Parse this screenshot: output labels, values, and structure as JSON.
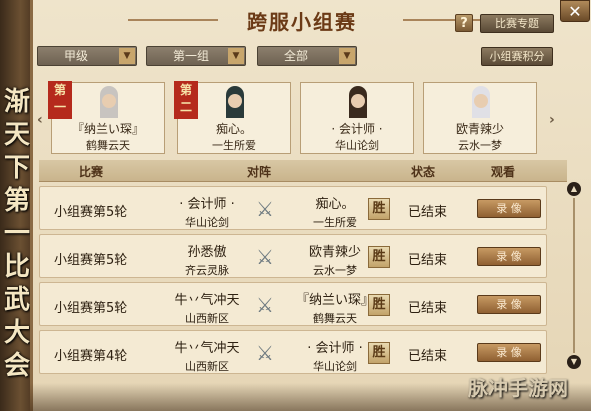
{
  "banner": {
    "text": "渐天下第一比武大会"
  },
  "header": {
    "title": "跨服小组赛",
    "help_label": "?",
    "topic_label": "比赛专题",
    "close_label": "✕"
  },
  "filters": {
    "level": "甲级",
    "group": "第一组",
    "scope": "全部",
    "points_label": "小组赛积分"
  },
  "nav": {
    "prev": "‹",
    "next": "›"
  },
  "cards": [
    {
      "rank": "第一",
      "name": "『纳兰い琛』",
      "server": "鹤舞云天"
    },
    {
      "rank": "第二",
      "name": "痴心。",
      "server": "一生所爱"
    },
    {
      "rank": "",
      "name": "· 会计师 ·",
      "server": "华山论剑"
    },
    {
      "rank": "",
      "name": "欧青辣少",
      "server": "云水一梦"
    }
  ],
  "table": {
    "headers": {
      "match": "比赛",
      "pair": "对阵",
      "status": "状态",
      "watch": "观看"
    },
    "rows": [
      {
        "round": "小组赛第5轮",
        "p1_name": "· 会计师 ·",
        "p1_server": "华山论剑",
        "p2_name": "痴心。",
        "p2_server": "一生所爱",
        "win": "胜",
        "status": "已结束",
        "rec": "录 像"
      },
      {
        "round": "小组赛第5轮",
        "p1_name": "孙悉傲",
        "p1_server": "齐云灵脉",
        "p2_name": "欧青辣少",
        "p2_server": "云水一梦",
        "win": "胜",
        "status": "已结束",
        "rec": "录 像"
      },
      {
        "round": "小组赛第5轮",
        "p1_name": "牛丷气冲天",
        "p1_server": "山西新区",
        "p2_name": "『纳兰い琛』",
        "p2_server": "鹤舞云天",
        "win": "胜",
        "status": "已结束",
        "rec": "录 像"
      },
      {
        "round": "小组赛第4轮",
        "p1_name": "牛丷气冲天",
        "p1_server": "山西新区",
        "p2_name": "· 会计师 ·",
        "p2_server": "华山论剑",
        "win": "胜",
        "status": "已结束",
        "rec": "录 像"
      }
    ]
  },
  "watermark": "脉冲手游网"
}
